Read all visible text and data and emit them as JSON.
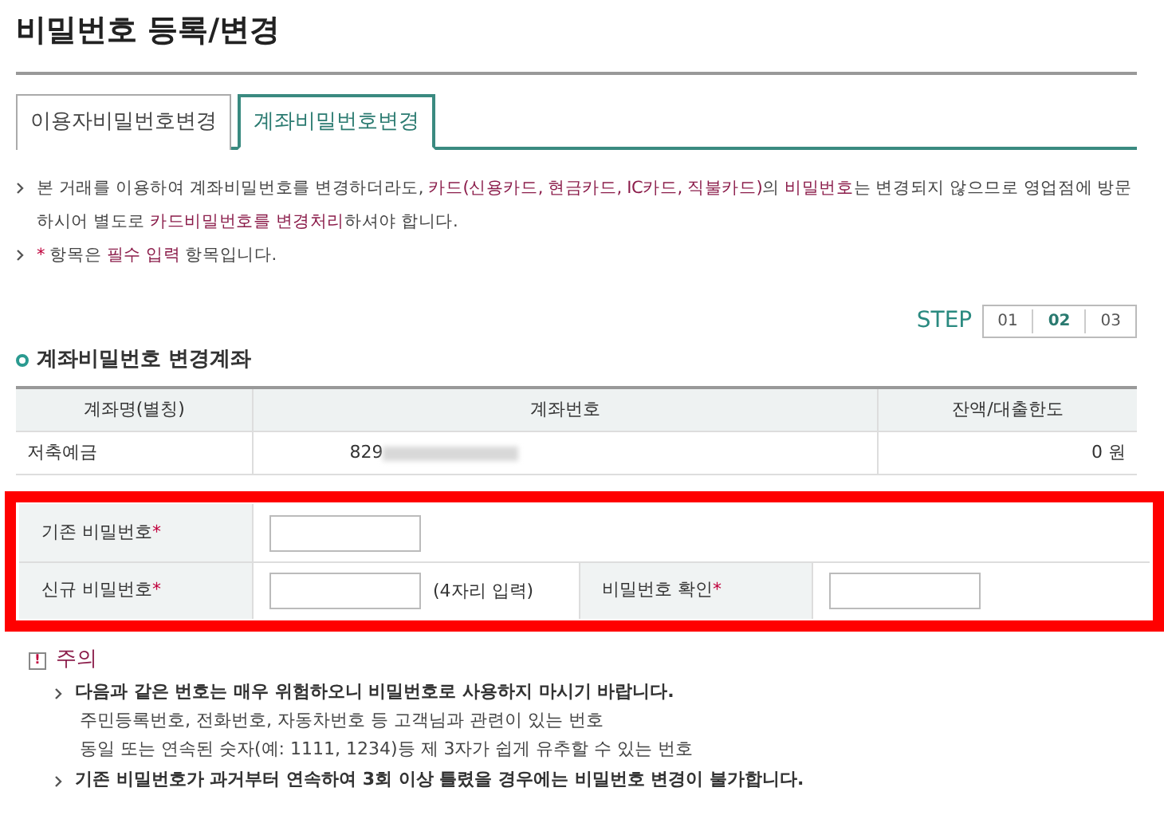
{
  "page_title": "비밀번호 등록/변경",
  "tabs": [
    {
      "label": "이용자비밀번호변경",
      "selected": false
    },
    {
      "label": "계좌비밀번호변경",
      "selected": true
    }
  ],
  "notes": [
    [
      {
        "kind": "plain",
        "text": "본 거래를 이용하여 계좌비밀번호를 변경하더라도, "
      },
      {
        "kind": "emphasis",
        "text": "카드(신용카드, 현금카드, IC카드, 직불카드)"
      },
      {
        "kind": "plain",
        "text": "의 "
      },
      {
        "kind": "emphasis",
        "text": "비밀번호"
      },
      {
        "kind": "plain",
        "text": "는 변경되지 않으므로 영업점에 방문하시어 별도로 "
      },
      {
        "kind": "emphasis",
        "text": "카드비밀번호를 변경처리"
      },
      {
        "kind": "plain",
        "text": "하셔야 합니다."
      }
    ],
    [
      {
        "kind": "mark",
        "text": "*"
      },
      {
        "kind": "plain",
        "text": " 항목은 "
      },
      {
        "kind": "emphasis",
        "text": "필수 입력"
      },
      {
        "kind": "plain",
        "text": " 항목입니다."
      }
    ]
  ],
  "steps": {
    "label": "STEP",
    "items": [
      {
        "label": "01",
        "selected": false
      },
      {
        "label": "02",
        "selected": true
      },
      {
        "label": "03",
        "selected": false
      }
    ]
  },
  "account_section": {
    "title": "계좌비밀번호 변경계좌",
    "columns": [
      "계좌명(별칭)",
      "계좌번호",
      "잔액/대출한도"
    ],
    "rows": [
      {
        "name": "저축예금",
        "number": "829",
        "number_redacted": true,
        "balance": "0 원"
      }
    ]
  },
  "form": {
    "highlighted": true,
    "required_mark": "*",
    "current_password": {
      "label": "기존 비밀번호"
    },
    "new_password": {
      "label": "신규 비밀번호",
      "hint": "(4자리 입력)"
    },
    "confirm_password": {
      "label": "비밀번호 확인"
    }
  },
  "caution": {
    "icon": "!",
    "title": "주의",
    "items": [
      {
        "text": "다음과 같은 번호는 매우 위험하오니 비밀번호로 사용하지 마시기 바랍니다.",
        "sub": [
          "주민등록번호, 전화번호, 자동차번호 등 고객님과 관련이 있는 번호",
          "동일 또는 연속된 숫자(예: 1111, 1234)등 제 3자가 쉽게 유추할 수 있는 번호"
        ]
      },
      {
        "text": "기존 비밀번호가 과거부터 연속하여 3회 이상 틀렸을 경우에는 비밀번호 변경이 불가합니다."
      }
    ]
  }
}
